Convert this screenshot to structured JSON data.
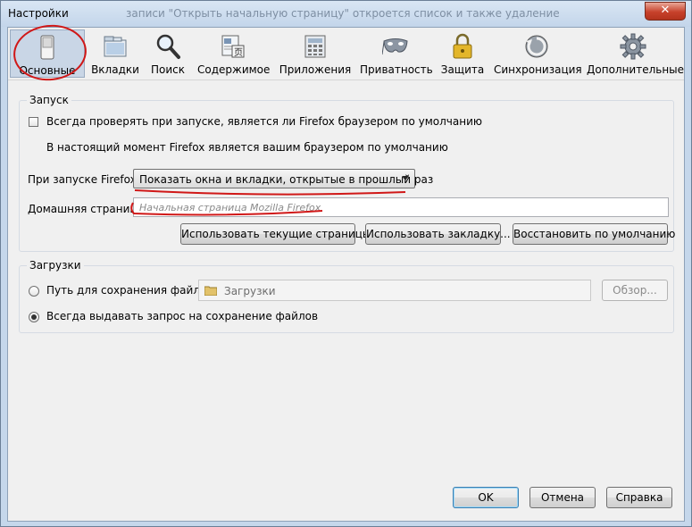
{
  "window": {
    "title": "Настройки",
    "ghost_text": "записи \"Открыть начальную страницу\" откроется список и также удаление",
    "close_label": "✕"
  },
  "toolbar": {
    "items": [
      {
        "label": "Основные",
        "icon": "switch-icon"
      },
      {
        "label": "Вкладки",
        "icon": "tabs-window-icon"
      },
      {
        "label": "Поиск",
        "icon": "magnifier-icon"
      },
      {
        "label": "Содержимое",
        "icon": "content-page-icon"
      },
      {
        "label": "Приложения",
        "icon": "calculator-apps-icon"
      },
      {
        "label": "Приватность",
        "icon": "mask-icon"
      },
      {
        "label": "Защита",
        "icon": "padlock-icon"
      },
      {
        "label": "Синхронизация",
        "icon": "sync-icon"
      },
      {
        "label": "Дополнительные",
        "icon": "gear-icon"
      }
    ],
    "selected": "Основные"
  },
  "startup": {
    "group_label": "Запуск",
    "check_default_label": "Всегда проверять при запуске, является ли Firefox браузером по умолчанию",
    "check_default_checked": false,
    "status_text": "В настоящий момент Firefox является вашим браузером по умолчанию",
    "on_start_label": "При запуске Firefox:",
    "on_start_value": "Показать окна и вкладки, открытые в прошлый раз",
    "homepage_label": "Домашняя страница:",
    "homepage_placeholder": "Начальная страница Mozilla Firefox",
    "btn_current": "Использовать текущие страницы",
    "btn_bookmark": "Использовать закладку...",
    "btn_restore": "Восстановить по умолчанию"
  },
  "downloads": {
    "group_label": "Загрузки",
    "save_path_label": "Путь для сохранения файлов",
    "save_path_value": "Загрузки",
    "browse_label": "Обзор...",
    "always_ask_label": "Всегда выдавать запрос на сохранение файлов",
    "selected_option": "always_ask"
  },
  "footer": {
    "ok": "OK",
    "cancel": "Отмена",
    "help": "Справка"
  },
  "colors": {
    "annotation": "#d01818",
    "selected_tab": "#c9d6e6"
  }
}
